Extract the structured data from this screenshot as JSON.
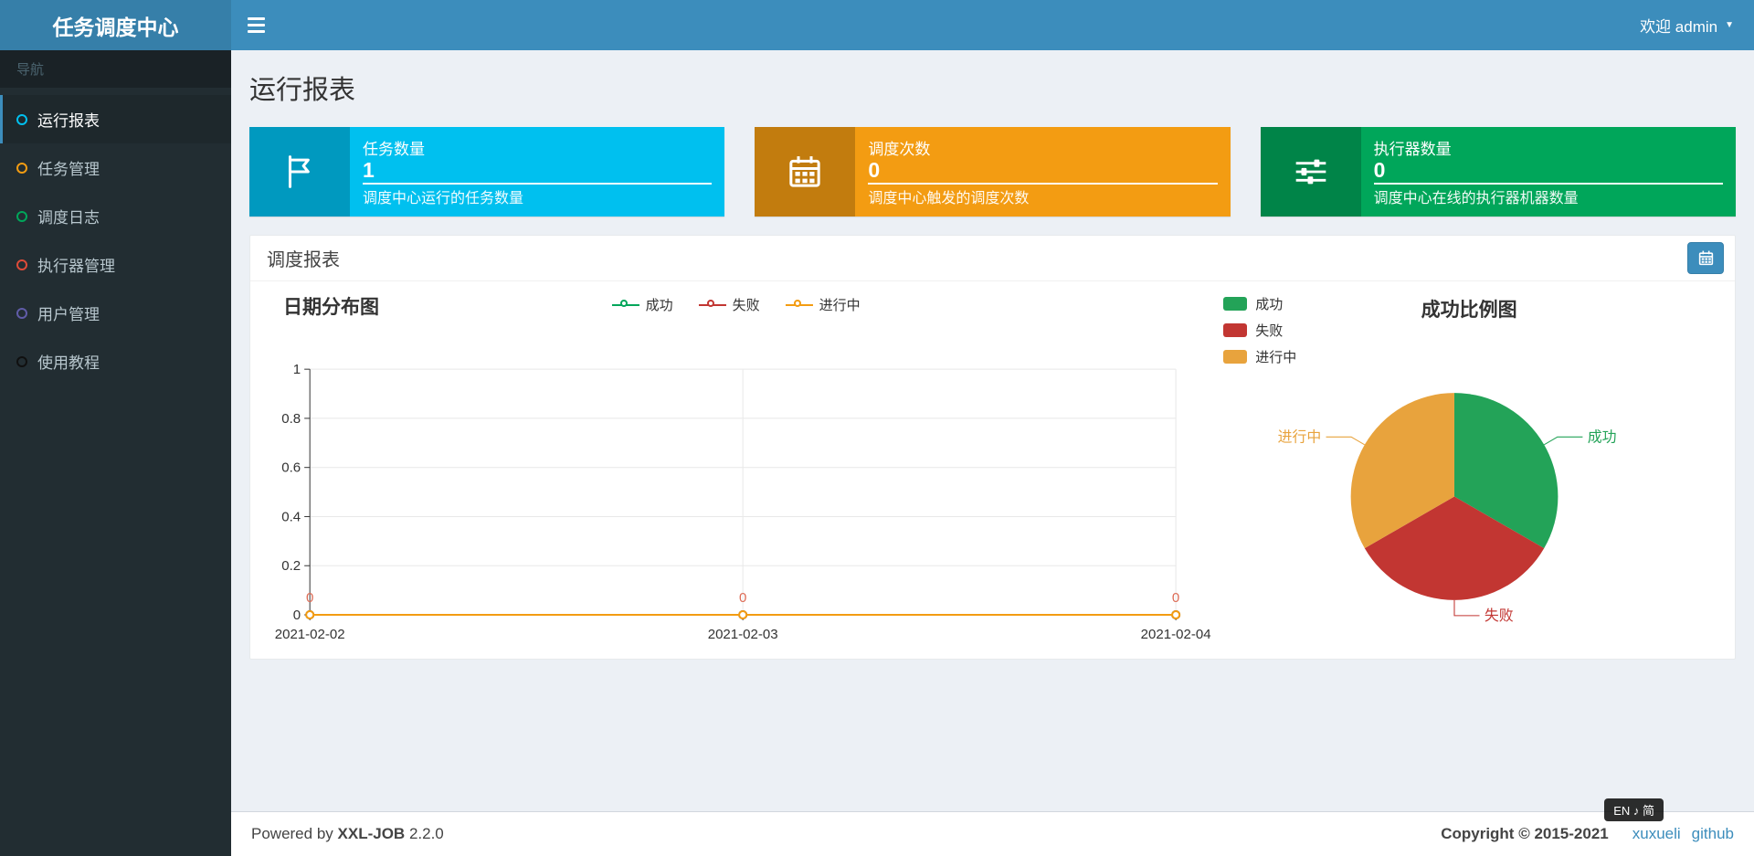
{
  "header": {
    "logo_text": "任务调度中心",
    "welcome_text": "欢迎 admin"
  },
  "sidebar": {
    "section_label": "导航",
    "items": [
      {
        "key": "run-report",
        "label": "运行报表",
        "icon_color": "#00c0ef",
        "active": true
      },
      {
        "key": "job-manage",
        "label": "任务管理",
        "icon_color": "#f39c12",
        "active": false
      },
      {
        "key": "job-log",
        "label": "调度日志",
        "icon_color": "#00a65a",
        "active": false
      },
      {
        "key": "executor-manage",
        "label": "执行器管理",
        "icon_color": "#dd4b39",
        "active": false
      },
      {
        "key": "user-manage",
        "label": "用户管理",
        "icon_color": "#605ca8",
        "active": false
      },
      {
        "key": "help",
        "label": "使用教程",
        "icon_color": "#101010",
        "active": false
      }
    ]
  },
  "page": {
    "title": "运行报表"
  },
  "info_boxes": [
    {
      "key": "job-count",
      "icon": "flag-icon",
      "title": "任务数量",
      "value": "1",
      "description": "调度中心运行的任务数量",
      "color": "#00c0ef"
    },
    {
      "key": "trigger-count",
      "icon": "calendar-icon",
      "title": "调度次数",
      "value": "0",
      "description": "调度中心触发的调度次数",
      "color": "#f39c12"
    },
    {
      "key": "executor-count",
      "icon": "sliders-icon",
      "title": "执行器数量",
      "value": "0",
      "description": "调度中心在线的执行器机器数量",
      "color": "#00a65a"
    }
  ],
  "report_panel": {
    "title": "调度报表"
  },
  "chart_data": [
    {
      "type": "line",
      "title": "日期分布图",
      "categories": [
        "2021-02-02",
        "2021-02-03",
        "2021-02-04"
      ],
      "series": [
        {
          "name": "成功",
          "color": "#00A65A",
          "values": [
            0,
            0,
            0
          ]
        },
        {
          "name": "失败",
          "color": "#C23632",
          "values": [
            0,
            0,
            0
          ]
        },
        {
          "name": "进行中",
          "color": "#F39C12",
          "values": [
            0,
            0,
            0
          ]
        }
      ],
      "ylim": [
        0,
        1
      ],
      "yticks": [
        0,
        0.2,
        0.4,
        0.6,
        0.8,
        1
      ],
      "point_label": "0",
      "point_label_color": "#DD6B55",
      "legend_position": "top-center",
      "grid": true
    },
    {
      "type": "pie",
      "title": "成功比例图",
      "legend_position": "top-left",
      "slices": [
        {
          "name": "成功",
          "value": 33.33,
          "color": "#23A358"
        },
        {
          "name": "失败",
          "value": 33.33,
          "color": "#C23632"
        },
        {
          "name": "进行中",
          "value": 33.34,
          "color": "#E8A33D"
        }
      ]
    }
  ],
  "footer": {
    "powered_by": "Powered by",
    "product": "XXL-JOB",
    "version": "2.2.0",
    "copyright": "Copyright © 2015-2021",
    "links": [
      "xuxueli",
      "github"
    ]
  },
  "ime_indicator": {
    "text": "EN ♪ 简"
  }
}
